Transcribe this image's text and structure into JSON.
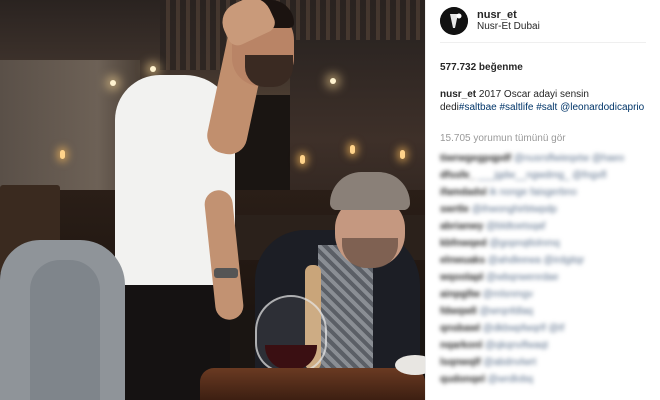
{
  "post": {
    "username": "nusr_et",
    "location": "Nusr-Et Dubai",
    "likes": "577.732 beğenme",
    "caption": {
      "user": "nusr_et",
      "text": " 2017 Oscar adayi sensin dedi",
      "hashtags": [
        "#saltbae",
        "#saltlife",
        "#salt"
      ],
      "mention": "@leonardodicaprio"
    },
    "view_comments": "15.705 yorumun tümünü gör"
  },
  "comments": [
    {
      "user": "tiwrwgegpqpdf",
      "text": "@nusrsflwieqxtw @haeo"
    },
    {
      "user": "dfssfe_",
      "text": "___jgdw__ngwdmg_ @fngxfl"
    },
    {
      "user": "ifamdadsl",
      "text": "ik nonge faisgerbno"
    },
    {
      "user": "swrtle",
      "text": "@ihwonghirbtwpdp"
    },
    {
      "user": "abrianwy",
      "text": "@bldtoetsqaf"
    },
    {
      "user": "kbfnwqed",
      "text": "@gopnqtlolnmq"
    },
    {
      "user": "elnwuaks",
      "text": "@ahdleewa @irdgitqr"
    },
    {
      "user": "wqoolapl",
      "text": "@wbqnwenrdae"
    },
    {
      "user": "ainpgllw",
      "text": "@mlsnmgv"
    },
    {
      "user": "fdwqwll",
      "text": "@wrqnfdlaq"
    },
    {
      "user": "qnsbawl",
      "text": "@dkbwpfwqrlf @tf"
    },
    {
      "user": "nqarkonl",
      "text": "@qkqnvlfwaqt"
    },
    {
      "user": "lsqnwqlf",
      "text": "@abdnvlwrt"
    },
    {
      "user": "qudonqel",
      "text": "@wrdlobq"
    }
  ],
  "colors": {
    "text": "#262626",
    "link": "#003569",
    "muted": "#999999",
    "divider": "#efefef"
  }
}
